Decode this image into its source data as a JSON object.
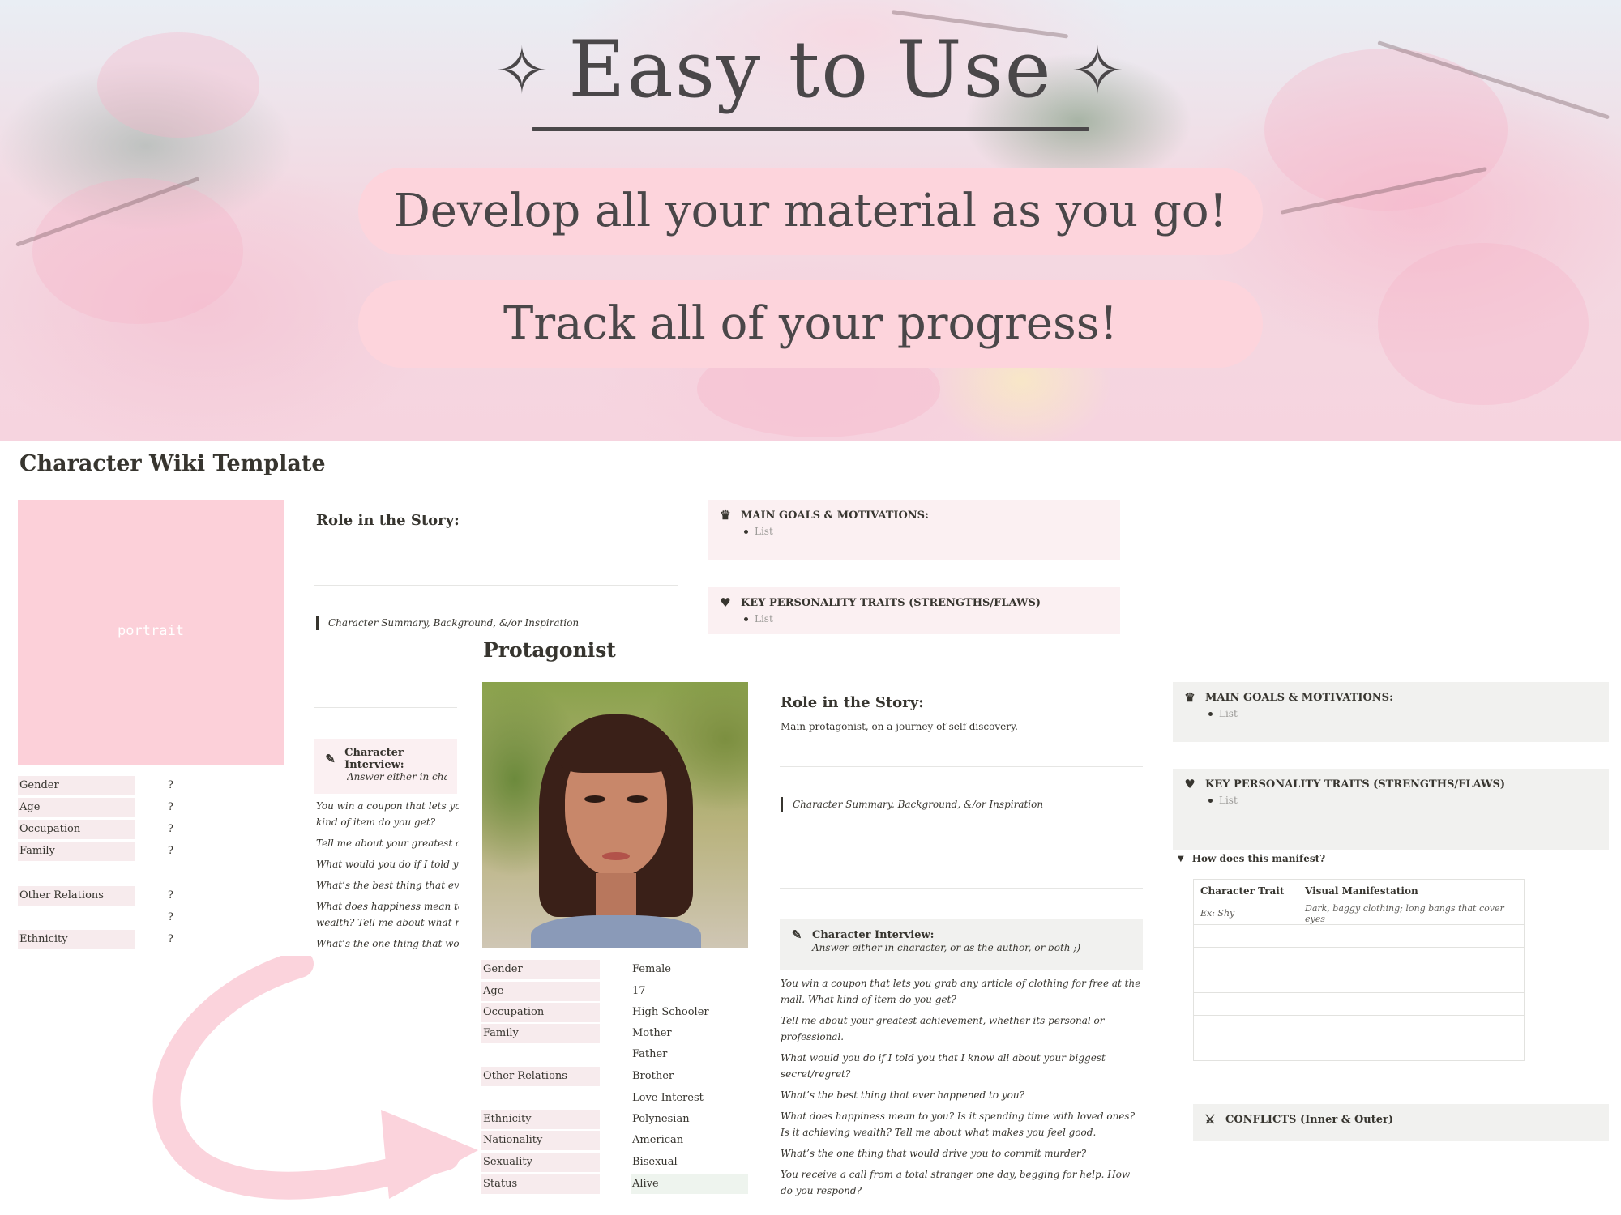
{
  "hero": {
    "title": "Easy to Use",
    "sparkle": "✧",
    "pill_1": "Develop all your material as you go!",
    "pill_2": "Track all of your progress!"
  },
  "template": {
    "page_title": "Character Wiki Template",
    "portrait_label": "portrait",
    "properties": [
      {
        "label": "Gender",
        "value": "?"
      },
      {
        "label": "Age",
        "value": "?"
      },
      {
        "label": "Occupation",
        "value": "?"
      },
      {
        "label": "Family",
        "value": "?"
      },
      {
        "label": "Other Relations",
        "value": "?"
      },
      {
        "label": "",
        "value": "?"
      },
      {
        "label": "Ethnicity",
        "value": "?"
      }
    ],
    "role_heading": "Role in the Story:",
    "summary_quote": "Character Summary, Background, &/or Inspiration",
    "goals_heading": "MAIN GOALS & MOTIVATIONS:",
    "traits_heading": "KEY PERSONALITY TRAITS (STRENGTHS/FLAWS)",
    "list_placeholder": "List",
    "interview_heading": "Character Interview:",
    "interview_sub": "Answer either in character,",
    "interview_questions": [
      "You win a coupon that lets you grab",
      "kind of item do you get?",
      "Tell me about your greatest achiev",
      "What would you do if I told you th",
      "What’s the best thing that ever hap",
      "What does happiness mean to you?",
      "wealth? Tell me about what makes",
      "What’s the one thing that would dr"
    ]
  },
  "protagonist": {
    "title": "Protagonist",
    "properties": [
      {
        "label": "Gender",
        "value": "Female"
      },
      {
        "label": "Age",
        "value": "17"
      },
      {
        "label": "Occupation",
        "value": "High Schooler"
      },
      {
        "label": "Family",
        "value": "Mother"
      },
      {
        "label": "",
        "value": "Father"
      },
      {
        "label": "Other Relations",
        "value": "Brother"
      },
      {
        "label": "",
        "value": "Love Interest"
      },
      {
        "label": "Ethnicity",
        "value": "Polynesian"
      },
      {
        "label": "Nationality",
        "value": "American"
      },
      {
        "label": "Sexuality",
        "value": "Bisexual"
      },
      {
        "label": "Status",
        "value": "Alive"
      }
    ],
    "role_heading": "Role in the Story:",
    "role_text": "Main protagonist, on a journey of self-discovery.",
    "summary_quote": "Character Summary, Background, &/or Inspiration",
    "interview_heading": "Character Interview:",
    "interview_sub": "Answer either in character, or as the author, or both ;)",
    "interview_questions": [
      "You win a coupon that lets you grab any article of clothing for free at the mall. What kind of item do you get?",
      "Tell me about your greatest achievement, whether its personal or professional.",
      "What would you do if I told you that I know all about your biggest secret/regret?",
      "What’s the best thing that ever happened to you?",
      "What does happiness mean to you? Is it spending time with loved ones? Is it achieving wealth? Tell me about what makes you feel good.",
      "What’s the one thing that would drive you to commit murder?",
      "You receive a call from a total stranger one day, begging for help. How do you respond?"
    ],
    "goals_heading": "MAIN GOALS & MOTIVATIONS:",
    "traits_heading": "KEY PERSONALITY TRAITS (STRENGTHS/FLAWS)",
    "list_placeholder": "List",
    "toggle_label": "How does this manifest?",
    "table": {
      "headers": [
        "Character Trait",
        "Visual Manifestation"
      ],
      "rows": [
        [
          "Ex: Shy",
          "Dark, baggy clothing; long bangs that cover eyes"
        ],
        [
          "",
          ""
        ],
        [
          "",
          ""
        ],
        [
          "",
          ""
        ],
        [
          "",
          ""
        ],
        [
          "",
          ""
        ],
        [
          "",
          ""
        ]
      ]
    },
    "conflicts_heading": "CONFLICTS (Inner & Outer)"
  },
  "colors": {
    "pink_pill": "#fdd4dc",
    "portrait_pink": "#fcd0d9",
    "text_dark": "#4a4749",
    "callout_pink": "#fbf0f2",
    "callout_gray": "#f1f1ef",
    "arrow_pink": "#fbd3dc"
  },
  "icons": [
    "sparkle-icon",
    "crown-icon",
    "heart-icon",
    "pencil-icon",
    "swords-icon",
    "toggle-triangle-icon"
  ]
}
